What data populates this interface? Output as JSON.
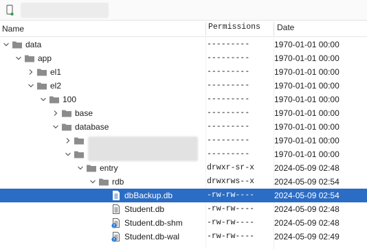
{
  "header": {
    "name": "Name",
    "permissions": "Permissions",
    "date": "Date"
  },
  "colors": {
    "selection": "#2b6cc4",
    "folder": "#8c8c8c",
    "device_dot": "#2ea043"
  },
  "rows": [
    {
      "label": "data",
      "perm": "---------",
      "date": "1970-01-01 00:00",
      "icon": "folder-icon",
      "chevron": "down"
    },
    {
      "label": "app",
      "perm": "---------",
      "date": "1970-01-01 00:00",
      "icon": "folder-icon",
      "chevron": "down"
    },
    {
      "label": "el1",
      "perm": "---------",
      "date": "1970-01-01 00:00",
      "icon": "folder-icon",
      "chevron": "right"
    },
    {
      "label": "el2",
      "perm": "---------",
      "date": "1970-01-01 00:00",
      "icon": "folder-icon",
      "chevron": "down"
    },
    {
      "label": "100",
      "perm": "---------",
      "date": "1970-01-01 00:00",
      "icon": "folder-icon",
      "chevron": "down"
    },
    {
      "label": "base",
      "perm": "---------",
      "date": "1970-01-01 00:00",
      "icon": "folder-icon",
      "chevron": "right"
    },
    {
      "label": "database",
      "perm": "---------",
      "date": "1970-01-01 00:00",
      "icon": "folder-icon",
      "chevron": "down"
    },
    {
      "label": "",
      "perm": "---------",
      "date": "1970-01-01 00:00",
      "icon": "folder-icon",
      "chevron": "right"
    },
    {
      "label": "",
      "perm": "---------",
      "date": "1970-01-01 00:00",
      "icon": "folder-icon",
      "chevron": "down"
    },
    {
      "label": "entry",
      "perm": "drwxr-sr-x",
      "date": "2024-05-09 02:48",
      "icon": "folder-icon",
      "chevron": "down"
    },
    {
      "label": "rdb",
      "perm": "drwxrws--x",
      "date": "2024-05-09 02:54",
      "icon": "folder-icon",
      "chevron": "down"
    },
    {
      "label": "dbBackup.db",
      "perm": "-rw-rw----",
      "date": "2024-05-09 02:54",
      "icon": "file-icon",
      "chevron": "none",
      "selected": true
    },
    {
      "label": "Student.db",
      "perm": "-rw-rw----",
      "date": "2024-05-09 02:48",
      "icon": "file-icon",
      "chevron": "none"
    },
    {
      "label": "Student.db-shm",
      "perm": "-rw-rw----",
      "date": "2024-05-09 02:48",
      "icon": "unknown-file-icon",
      "chevron": "none"
    },
    {
      "label": "Student.db-wal",
      "perm": "-rw-rw----",
      "date": "2024-05-09 02:49",
      "icon": "unknown-file-icon",
      "chevron": "none"
    }
  ]
}
